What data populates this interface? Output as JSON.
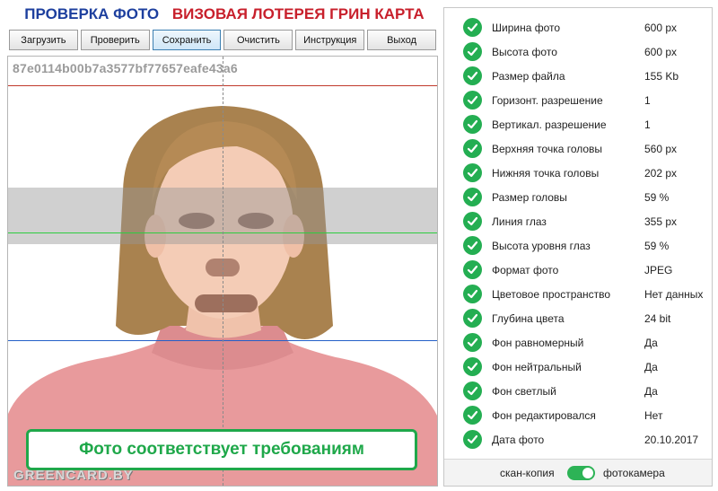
{
  "header": {
    "title_left": "ПРОВЕРКА ФОТО",
    "title_right": "ВИЗОВАЯ ЛОТЕРЕЯ ГРИН КАРТА"
  },
  "toolbar": {
    "buttons": [
      {
        "label": "Загрузить"
      },
      {
        "label": "Проверить"
      },
      {
        "label": "Сохранить",
        "active": true
      },
      {
        "label": "Очистить"
      },
      {
        "label": "Инструкция"
      },
      {
        "label": "Выход"
      }
    ]
  },
  "photo": {
    "hash": "87e0114b00b7a3577bf77657eafe43a6",
    "status": "Фото соответствует требованиям",
    "watermark": "GREENCARD.BY",
    "line_colors": {
      "top": "#c0392b",
      "eyes": "#2ecc40",
      "bottom": "#2460c8"
    }
  },
  "checks": [
    {
      "label": "Ширина фото",
      "value": "600 px"
    },
    {
      "label": "Высота фото",
      "value": "600 px"
    },
    {
      "label": "Размер файла",
      "value": "155 Kb"
    },
    {
      "label": "Горизонт. разрешение",
      "value": "1"
    },
    {
      "label": "Вертикал. разрешение",
      "value": "1"
    },
    {
      "label": "Верхняя точка головы",
      "value": "560 px"
    },
    {
      "label": "Нижняя точка головы",
      "value": "202 px"
    },
    {
      "label": "Размер головы",
      "value": "59 %"
    },
    {
      "label": "Линия глаз",
      "value": "355 px"
    },
    {
      "label": "Высота уровня глаз",
      "value": "59 %"
    },
    {
      "label": "Формат фото",
      "value": "JPEG"
    },
    {
      "label": "Цветовое пространство",
      "value": "Нет данных"
    },
    {
      "label": "Глубина цвета",
      "value": "24 bit"
    },
    {
      "label": "Фон равномерный",
      "value": "Да"
    },
    {
      "label": "Фон нейтральный",
      "value": "Да"
    },
    {
      "label": "Фон светлый",
      "value": "Да"
    },
    {
      "label": "Фон редактировался",
      "value": "Нет"
    },
    {
      "label": "Дата фото",
      "value": "20.10.2017"
    }
  ],
  "source_toggle": {
    "left_label": "скан-копия",
    "right_label": "фотокамера",
    "state": "фотокамера"
  },
  "colors": {
    "accent_green": "#24ae52",
    "title_blue": "#1d3f9e",
    "title_red": "#c8202c"
  },
  "icons": {
    "check": "check-circle-icon"
  }
}
